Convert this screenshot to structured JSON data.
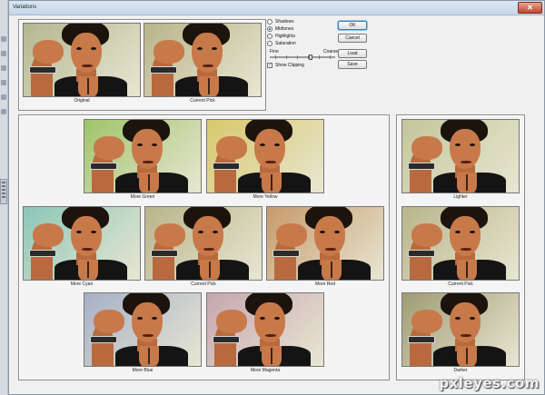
{
  "window": {
    "title": "Variations",
    "close_label": "✕"
  },
  "top_thumbs": [
    {
      "caption": "Original"
    },
    {
      "caption": "Current Pick"
    }
  ],
  "adjust_options": [
    {
      "label": "Shadows",
      "selected": false
    },
    {
      "label": "Midtones",
      "selected": true
    },
    {
      "label": "Highlights",
      "selected": false
    },
    {
      "label": "Saturation",
      "selected": false
    }
  ],
  "slider": {
    "min_label": "Fine",
    "max_label": "Coarse",
    "value": 0.62
  },
  "show_clipping": {
    "label": "Show Clipping",
    "checked": true
  },
  "buttons": {
    "ok": "OK",
    "cancel": "Cancel",
    "load": "Load",
    "save": "Save"
  },
  "color_variations": [
    {
      "caption": "More Green",
      "tint": "#9fc46a"
    },
    {
      "caption": "More Yellow",
      "tint": "#d8c86a"
    },
    {
      "caption": "More Cyan",
      "tint": "#8cc6b8"
    },
    {
      "caption": "Current Pick",
      "tint": "#b9b48a"
    },
    {
      "caption": "More Red",
      "tint": "#c69a6c"
    },
    {
      "caption": "More Blue",
      "tint": "#a6b0c8"
    },
    {
      "caption": "More Magenta",
      "tint": "#c7a6b0"
    }
  ],
  "brightness_variations": [
    {
      "caption": "Lighter",
      "tint": "#c3c69a"
    },
    {
      "caption": "Current Pick",
      "tint": "#b9b48a"
    },
    {
      "caption": "Darker",
      "tint": "#9f9c74"
    }
  ],
  "watermark": "pxleyes.com"
}
